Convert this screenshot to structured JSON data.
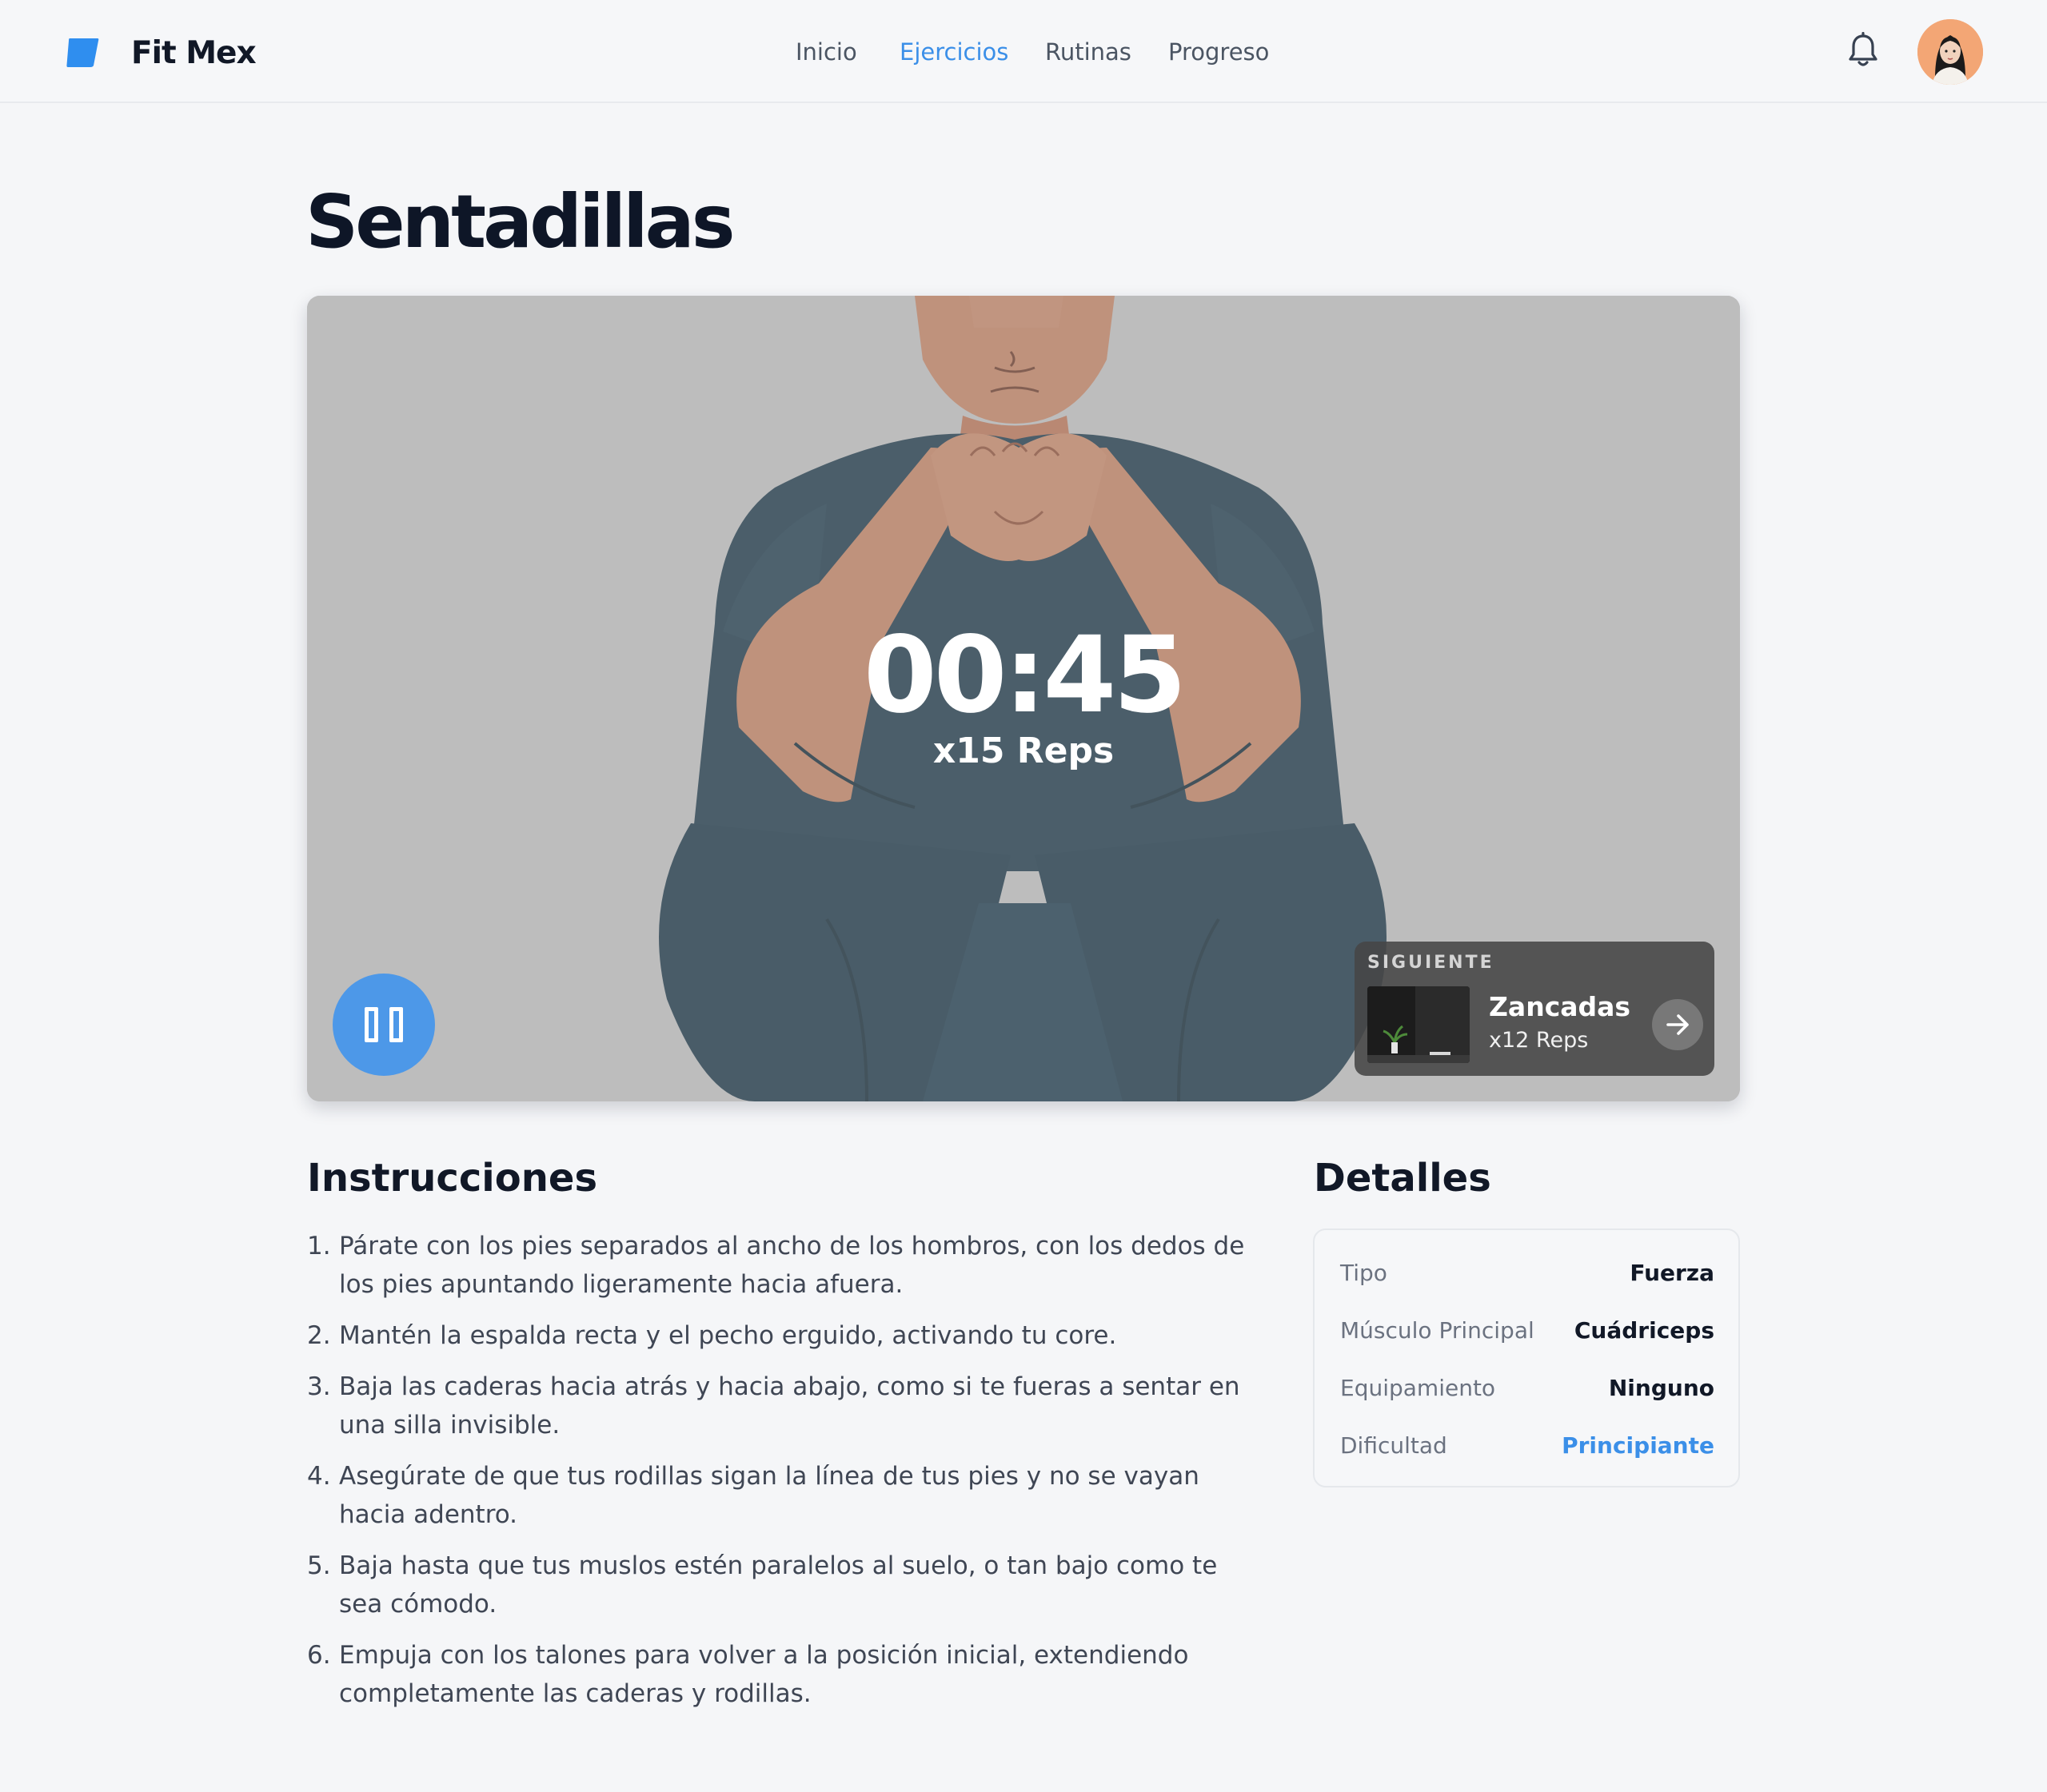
{
  "header": {
    "brand": "Fit Mex",
    "nav": [
      {
        "label": "Inicio",
        "active": false
      },
      {
        "label": "Ejercicios",
        "active": true
      },
      {
        "label": "Rutinas",
        "active": false
      },
      {
        "label": "Progreso",
        "active": false
      }
    ],
    "icons": {
      "logo": "logo-mark-icon",
      "notifications": "bell-icon",
      "profile": "avatar"
    }
  },
  "exercise": {
    "title": "Sentadillas",
    "timer": "00:45",
    "reps": "x15 Reps",
    "controls": {
      "pause_icon": "pause-icon"
    },
    "next": {
      "kicker": "SIGUIENTE",
      "name": "Zancadas",
      "reps": "x12 Reps",
      "arrow_icon": "arrow-right-icon"
    }
  },
  "instructions": {
    "heading": "Instrucciones",
    "steps": [
      {
        "num": "1.",
        "text": "Párate con los pies separados al ancho de los hombros, con los dedos de los pies apuntando ligeramente hacia afuera."
      },
      {
        "num": "2.",
        "text": "Mantén la espalda recta y el pecho erguido, activando tu core."
      },
      {
        "num": "3.",
        "text": "Baja las caderas hacia atrás y hacia abajo, como si te fueras a sentar en una silla invisible."
      },
      {
        "num": "4.",
        "text": "Asegúrate de que tus rodillas sigan la línea de tus pies y no se vayan hacia adentro."
      },
      {
        "num": "5.",
        "text": "Baja hasta que tus muslos estén paralelos al suelo, o tan bajo como te sea cómodo."
      },
      {
        "num": "6.",
        "text": "Empuja con los talones para volver a la posición inicial, extendiendo completamente las caderas y rodillas."
      }
    ]
  },
  "details": {
    "heading": "Detalles",
    "rows": [
      {
        "label": "Tipo",
        "value": "Fuerza"
      },
      {
        "label": "Músculo Principal",
        "value": "Cuádriceps"
      },
      {
        "label": "Equipamiento",
        "value": "Ninguno"
      },
      {
        "label": "Dificultad",
        "value": "Principiante"
      }
    ]
  },
  "colors": {
    "accent": "#3b8fe8",
    "title": "#0e1627",
    "background": "#f5f6f8",
    "shirt": "#1f3a4a",
    "skin": "#c08163"
  }
}
